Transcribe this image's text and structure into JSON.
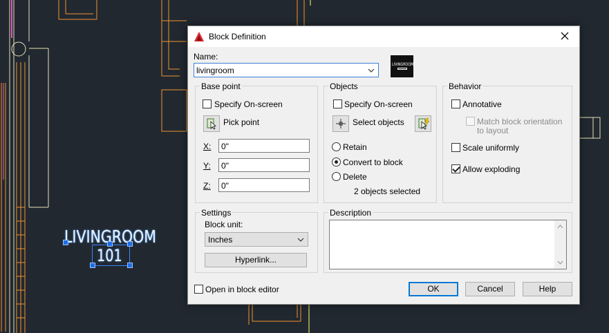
{
  "cad": {
    "room_name": "LIVINGROOM",
    "room_number": "101"
  },
  "dialog": {
    "title": "Block Definition",
    "close_glyph": "✕",
    "name_label": "Name:",
    "name_value": "livingroom",
    "preview_text": "LIVINGROOM",
    "base_point": {
      "title": "Base point",
      "specify_on_screen": "Specify On-screen",
      "pick_point": "Pick point",
      "x_label": "X:",
      "y_label": "Y:",
      "z_label": "Z:",
      "x_value": "0\"",
      "y_value": "0\"",
      "z_value": "0\""
    },
    "objects": {
      "title": "Objects",
      "specify_on_screen": "Specify On-screen",
      "select_objects": "Select objects",
      "retain": "Retain",
      "convert_to_block": "Convert to block",
      "delete": "Delete",
      "selected_count": "2 objects selected"
    },
    "behavior": {
      "title": "Behavior",
      "annotative": "Annotative",
      "match_orientation_line1": "Match block orientation",
      "match_orientation_line2": "to layout",
      "scale_uniformly": "Scale uniformly",
      "allow_exploding": "Allow exploding"
    },
    "settings": {
      "title": "Settings",
      "block_unit_label": "Block unit:",
      "block_unit_value": "Inches",
      "hyperlink": "Hyperlink..."
    },
    "description": {
      "title": "Description"
    },
    "open_in_editor": "Open in block editor",
    "ok": "OK",
    "cancel": "Cancel",
    "help": "Help"
  }
}
